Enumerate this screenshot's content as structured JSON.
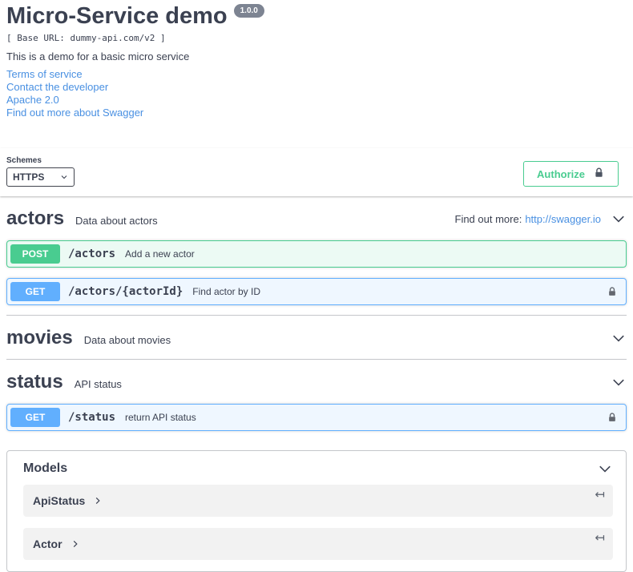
{
  "info": {
    "title": "Micro-Service demo",
    "version": "1.0.0",
    "base_url": "[ Base URL: dummy-api.com/v2 ]",
    "description": "This is a demo for a basic micro service",
    "links": [
      {
        "label": "Terms of service"
      },
      {
        "label": "Contact the developer"
      },
      {
        "label": "Apache 2.0"
      },
      {
        "label": "Find out more about Swagger"
      }
    ]
  },
  "scheme": {
    "label": "Schemes",
    "selected": "HTTPS",
    "authorize_label": "Authorize"
  },
  "tags": [
    {
      "name": "actors",
      "description": "Data about actors",
      "external_docs_prefix": "Find out more:",
      "external_docs_url": "http://swagger.io",
      "operations": [
        {
          "method": "POST",
          "path": "/actors",
          "summary": "Add a new actor"
        },
        {
          "method": "GET",
          "path": "/actors/{actorId}",
          "summary": "Find actor by ID"
        }
      ]
    },
    {
      "name": "movies",
      "description": "Data about movies",
      "operations": []
    },
    {
      "name": "status",
      "description": "API status",
      "operations": [
        {
          "method": "GET",
          "path": "/status",
          "summary": "return API status"
        }
      ]
    }
  ],
  "models": {
    "title": "Models",
    "items": [
      {
        "name": "ApiStatus"
      },
      {
        "name": "Actor"
      }
    ]
  },
  "icons": {
    "authorize_lock": "lock-icon",
    "operation_lock": "lock-icon",
    "section_toggle": "chevron-down-icon",
    "model_toggle": "chevron-right-icon",
    "model_return": "return-arrow-icon",
    "scheme_caret": "caret-down-icon"
  },
  "colors": {
    "post": "#49cc90",
    "get": "#61affe",
    "link": "#4990e2",
    "text": "#3b4151",
    "badge_bg": "#7d8492"
  }
}
